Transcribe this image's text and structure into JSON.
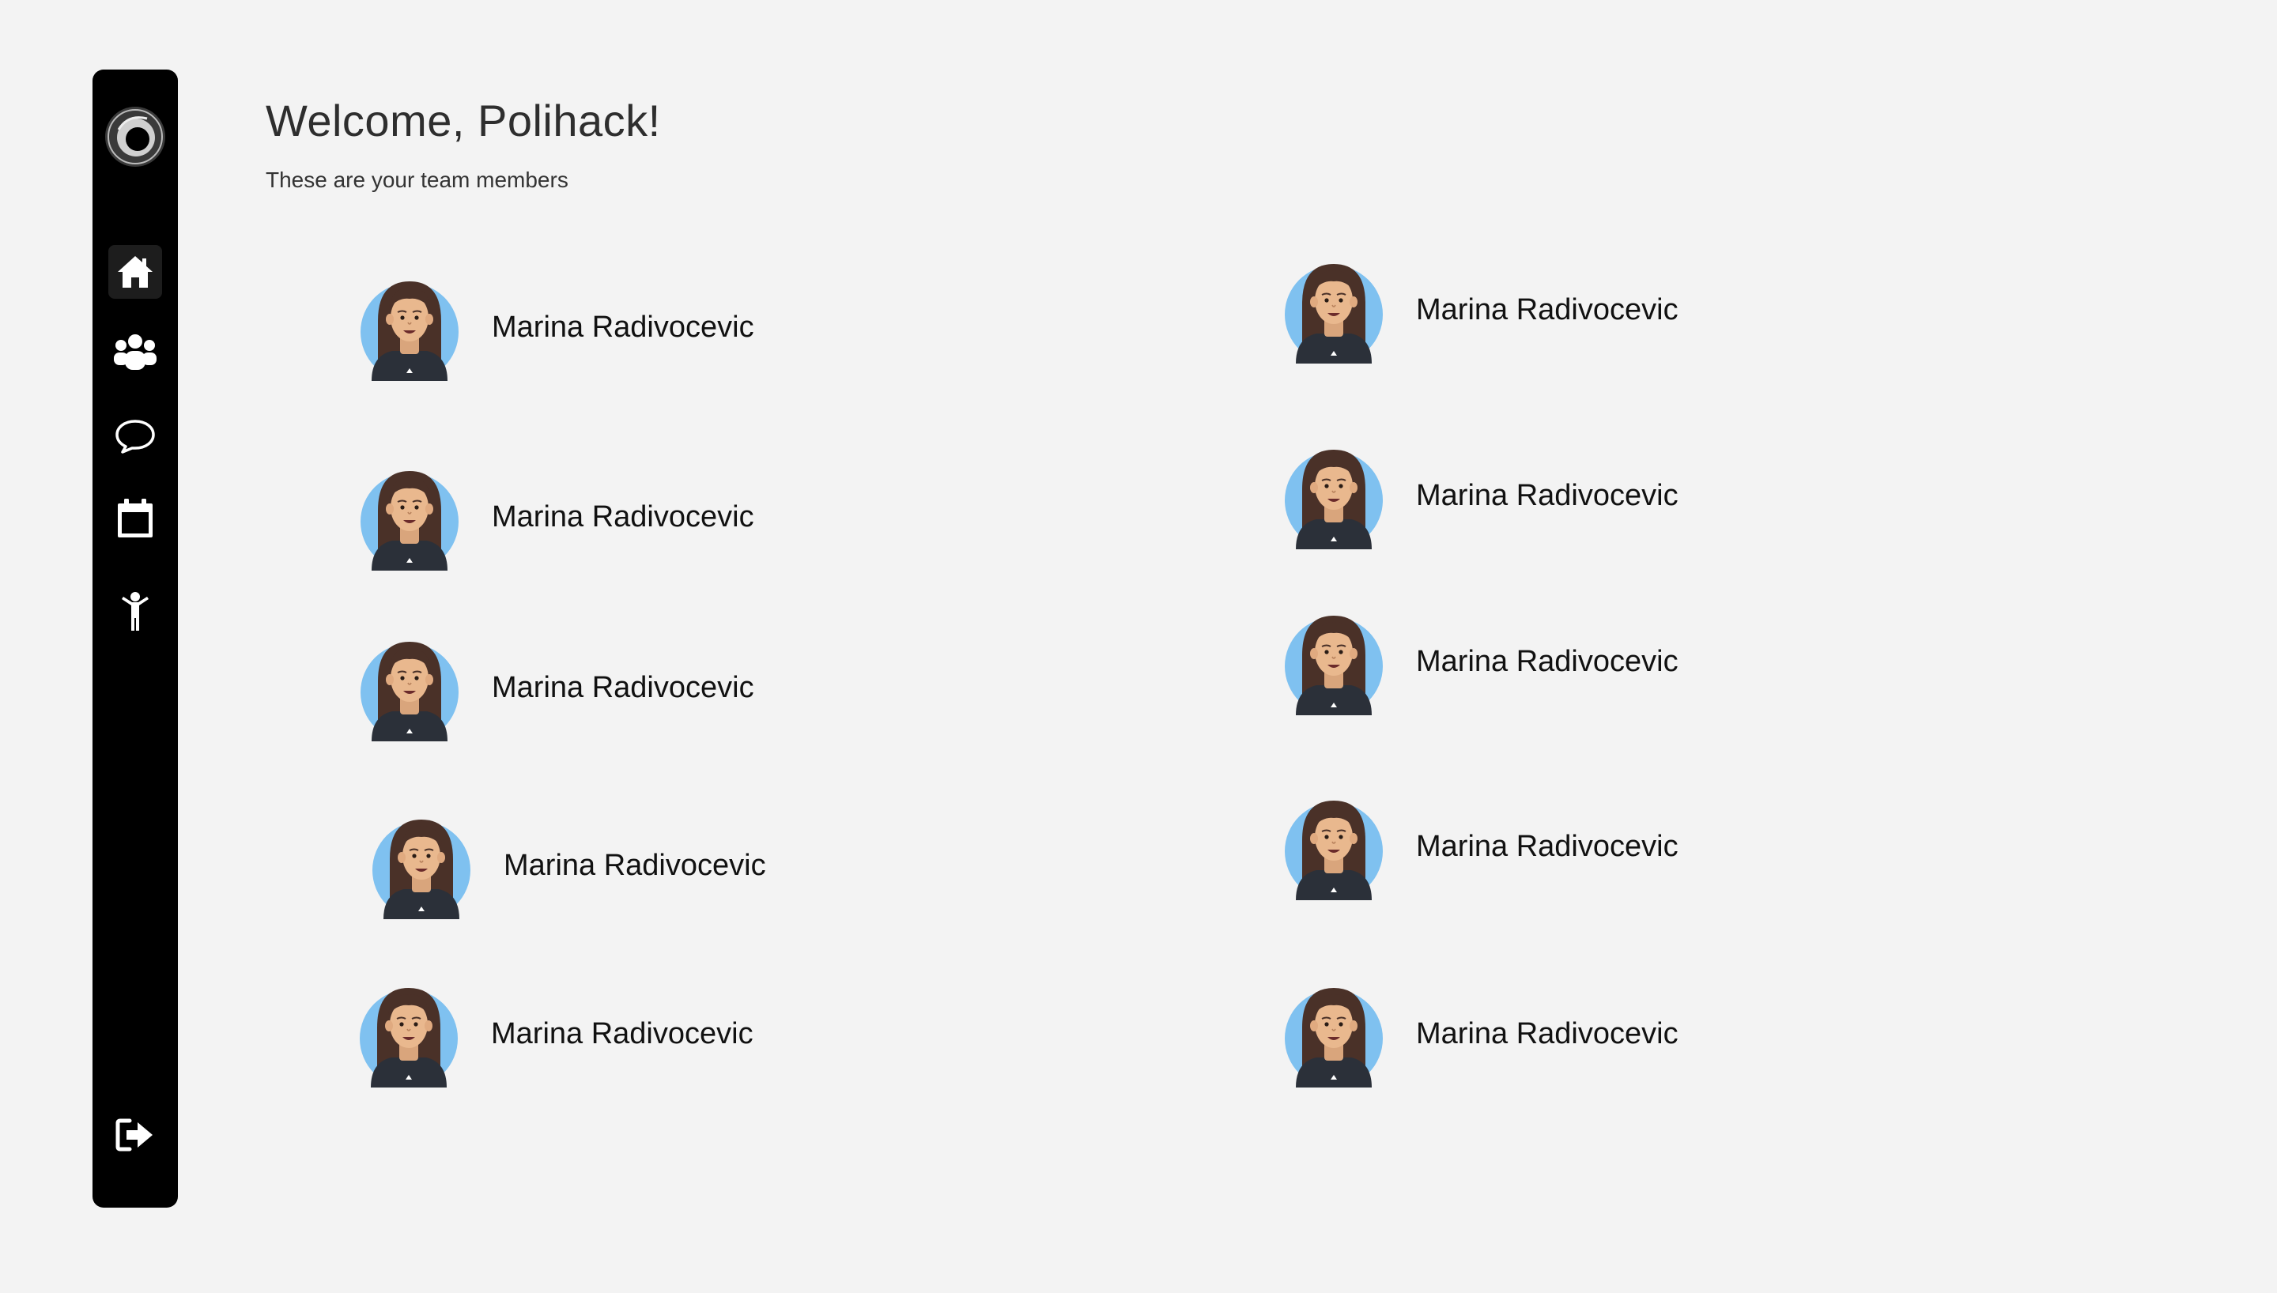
{
  "header": {
    "title": "Welcome, Polihack!",
    "subtitle": "These are your team members"
  },
  "sidebar": {
    "logo_icon": "ring-logo",
    "items": [
      {
        "icon": "home-icon",
        "active": true
      },
      {
        "icon": "team-icon",
        "active": false
      },
      {
        "icon": "chat-bubble-icon",
        "active": false
      },
      {
        "icon": "calendar-icon",
        "active": false
      },
      {
        "icon": "person-icon",
        "active": false
      }
    ],
    "logout_icon": "logout-icon"
  },
  "members": [
    {
      "name": "Marina Radivocevic"
    },
    {
      "name": "Marina Radivocevic"
    },
    {
      "name": "Marina Radivocevic"
    },
    {
      "name": "Marina Radivocevic"
    },
    {
      "name": "Marina Radivocevic"
    },
    {
      "name": "Marina Radivocevic"
    },
    {
      "name": "Marina Radivocevic"
    },
    {
      "name": "Marina Radivocevic"
    },
    {
      "name": "Marina Radivocevic"
    },
    {
      "name": "Marina Radivocevic"
    }
  ],
  "colors": {
    "background": "#f3f3f3",
    "sidebar": "#000000",
    "avatar_bg": "#7fc1f0",
    "hair": "#4a3128",
    "skin": "#e9b88e",
    "shirt": "#2b3039"
  }
}
